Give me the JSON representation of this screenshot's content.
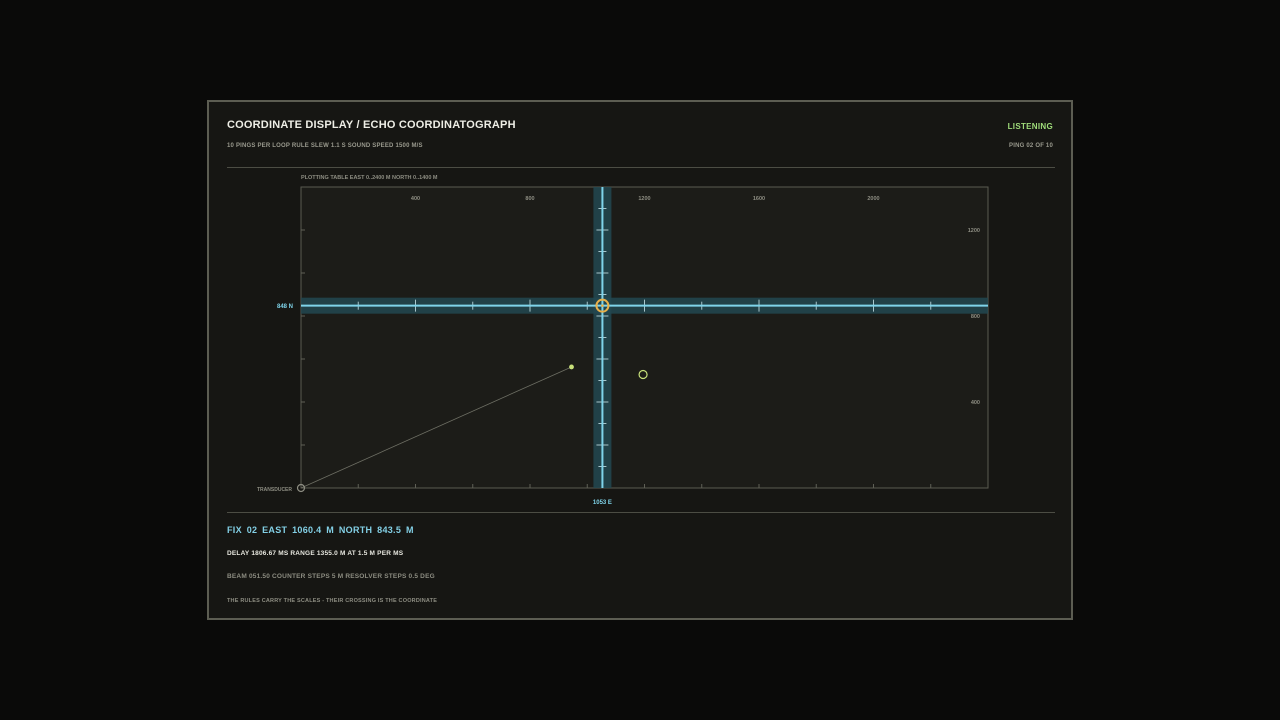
{
  "header": {
    "title": "COORDINATE DISPLAY / ECHO COORDINATOGRAPH",
    "status": "LISTENING",
    "subtitle": "10 PINGS PER LOOP   RULE SLEW 1.1 S   SOUND SPEED 1500 M/S",
    "ping_counter": "PING 02 OF 10"
  },
  "plot": {
    "caption": "PLOTTING TABLE   EAST 0..2400 M   NORTH 0..1400 M",
    "east_range": [
      0,
      2400
    ],
    "north_range": [
      0,
      1400
    ],
    "east_tick_labels": [
      "400",
      "800",
      "1200",
      "1600",
      "2000"
    ],
    "north_tick_labels": [
      "1200",
      "800",
      "400"
    ],
    "transducer_label": "TRANSDUCER",
    "transducer_east": 0,
    "transducer_north": 0,
    "north_rule_label": "848 N",
    "east_rule_label": "1053 E",
    "north_rule_value": 848,
    "east_rule_value": 1053,
    "echo_point": {
      "east": 945,
      "north": 563
    },
    "fix_marker": {
      "east": 1195,
      "north": 528
    },
    "colors": {
      "rule": "#7fd4ea",
      "rule_band": "#224851",
      "crossing": "#e8b04a",
      "echo": "#c7e07a",
      "fix_ring": "#c7e07a"
    }
  },
  "readout": {
    "fix": "FIX 02   EAST  1060.4 M   NORTH  843.5 M",
    "delay": "DELAY 1806.67 MS   RANGE  1355.0 M   AT   1.5 M PER MS",
    "beam": "BEAM 051.50   COUNTER STEPS 5 M   RESOLVER STEPS 0.5 DEG",
    "footnote": "THE RULES CARRY THE SCALES - THEIR CROSSING IS THE COORDINATE"
  }
}
